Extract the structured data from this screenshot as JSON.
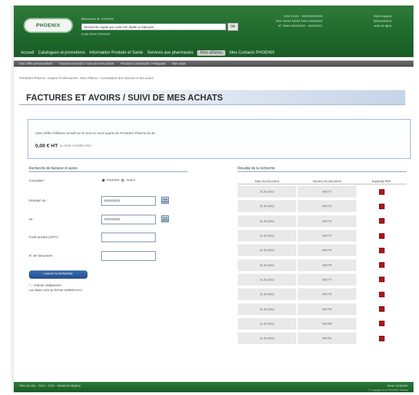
{
  "header": {
    "logo_text": "PHOENIX",
    "welcome_line": "Bienvenue M. XXXXXX",
    "search_value": "Recherche rapide par code CIP, libellé ou fabricant",
    "search_button": "OK",
    "sub_line": "Code client XXXXXX",
    "account_lines": [
      "XXX XXXX - XXXXXXXXXX",
      "XXX XXXX XXXX XXX XXXXXXX",
      "N° client XXXXXXX - XXXXXXX"
    ],
    "right_lines": [
      "Votre espace",
      "Déconnexion",
      "Aide en ligne"
    ]
  },
  "topnav": {
    "items": [
      "Accueil",
      "Catalogues et promotions",
      "Information Produits et Santé",
      "Services aux pharmacies",
      "Mes affaires",
      "Mes Contacts PHOENIX"
    ],
    "active_index": 4
  },
  "subnav": {
    "items": [
      "Mon offre personnalisée",
      "Factures et avoirs / suivi de mes achats",
      "Produits commandés / Reliquats",
      "Mes stats"
    ]
  },
  "breadcrumb": "PHOENIX Pharma › Espace Professionnel › Mes Affaires › Consultation des factures et des avoirs",
  "page_title": "FACTURES ET AVOIRS / SUIVI DE MES ACHATS",
  "info": {
    "line": "Votre chiffre d'affaires cumulé sur le mois en cours auprès de PHOENIX Pharma est de :",
    "amount": "0,00 € HT",
    "date_note": "au mardi 2 octobre 2012"
  },
  "form": {
    "title": "Recherche de factures et avoirs",
    "consult_label": "Consulter* :",
    "radio_factures": "Factures",
    "radio_avoirs": "Avoirs",
    "period_from_label": "Période* du :",
    "period_from_value": "01/03/2012",
    "period_to_label": "au :",
    "period_to_value": "31/03/2012",
    "product_code_label": "Code produit (CIP7) :",
    "product_code_value": "",
    "document_label": "N° de document :",
    "document_value": "",
    "launch_button": "Lancer la recherche",
    "note_required": "* = champs obligatoires",
    "note_dates": "Les dates sont au format JJ/MM/AAAA"
  },
  "results": {
    "title": "Résultat de la recherche",
    "columns": [
      "Date du document",
      "Numéro du document",
      "Duplicata PDF"
    ],
    "rows": [
      {
        "date": "31.03.2012",
        "number": "004771"
      },
      {
        "date": "31.03.2012",
        "number": "004772"
      },
      {
        "date": "31.03.2012",
        "number": "004773"
      },
      {
        "date": "31.03.2012",
        "number": "004774"
      },
      {
        "date": "31.03.2012",
        "number": "004775"
      },
      {
        "date": "31.03.2012",
        "number": "004776"
      },
      {
        "date": "31.03.2012",
        "number": "004777"
      },
      {
        "date": "31.03.2012",
        "number": "004778"
      },
      {
        "date": "31.03.2012",
        "number": "004779"
      },
      {
        "date": "31.03.2012",
        "number": "004780"
      },
      {
        "date": "31.03.2012",
        "number": "004781"
      }
    ]
  },
  "footer": {
    "links": "Plan du site · CGU · CGV · Mentions légales",
    "right": "Nous contacter",
    "copyright": "© Copyright 2012 PHOENIX Pharma"
  },
  "colors": {
    "brand_green": "#1f6a2c",
    "accent_blue": "#224d8c",
    "pdf_red": "#b0161b"
  }
}
